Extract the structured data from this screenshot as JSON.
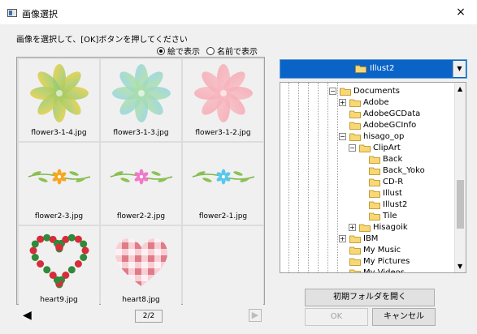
{
  "window": {
    "title": "画像選択",
    "close_glyph": "×"
  },
  "instruction": "画像を選択して、[OK]ボタンを押してください",
  "view_mode": {
    "options": [
      {
        "label": "絵で表示",
        "selected": true
      },
      {
        "label": "名前で表示",
        "selected": false
      }
    ]
  },
  "images": [
    {
      "name": "flower3-1-4.jpg",
      "kind": "flower",
      "colors": [
        "#f2d03a",
        "#7cc97f"
      ]
    },
    {
      "name": "flower3-1-3.jpg",
      "kind": "flower",
      "colors": [
        "#8fd3e8",
        "#b7e38e"
      ]
    },
    {
      "name": "flower3-1-2.jpg",
      "kind": "flower",
      "colors": [
        "#f7a6b0",
        "#f7c1c8"
      ]
    },
    {
      "name": "flower2-3.jpg",
      "kind": "vine",
      "colors": [
        "#f5a623"
      ]
    },
    {
      "name": "flower2-2.jpg",
      "kind": "vine",
      "colors": [
        "#f07ac9"
      ]
    },
    {
      "name": "flower2-1.jpg",
      "kind": "vine",
      "colors": [
        "#5ac8e8"
      ]
    },
    {
      "name": "heart9.jpg",
      "kind": "wreath",
      "colors": [
        "#d62d3a",
        "#2f8a3a"
      ]
    },
    {
      "name": "heart8.jpg",
      "kind": "check",
      "colors": [
        "#e07b88",
        "#f7d0d6"
      ]
    },
    {
      "name": "",
      "kind": "empty",
      "colors": []
    }
  ],
  "pager": {
    "page": "2/2",
    "prev_glyph": "◀",
    "next_glyph": "▶"
  },
  "folder_dropdown": {
    "value": "Illust2",
    "arrow_glyph": "▼"
  },
  "tree": {
    "items": [
      {
        "label": "Documents",
        "toggle": "−"
      },
      {
        "label": "Adobe",
        "toggle": "+"
      },
      {
        "label": "AdobeGCData",
        "toggle": ""
      },
      {
        "label": "AdobeGCInfo",
        "toggle": ""
      },
      {
        "label": "hisago_op",
        "toggle": "−"
      },
      {
        "label": "ClipArt",
        "toggle": "−"
      },
      {
        "label": "Back",
        "toggle": ""
      },
      {
        "label": "Back_Yoko",
        "toggle": ""
      },
      {
        "label": "CD-R",
        "toggle": ""
      },
      {
        "label": "Illust",
        "toggle": ""
      },
      {
        "label": "Illust2",
        "toggle": ""
      },
      {
        "label": "Tile",
        "toggle": ""
      },
      {
        "label": "Hisagoik",
        "toggle": "+"
      },
      {
        "label": "IBM",
        "toggle": "+"
      },
      {
        "label": "My Music",
        "toggle": ""
      },
      {
        "label": "My Pictures",
        "toggle": ""
      },
      {
        "label": "My Videos",
        "toggle": ""
      }
    ],
    "scroll_up_glyph": "▲",
    "scroll_down_glyph": "▼"
  },
  "buttons": {
    "open_initial_folder": "初期フォルダを開く",
    "ok": "OK",
    "cancel": "キャンセル"
  }
}
